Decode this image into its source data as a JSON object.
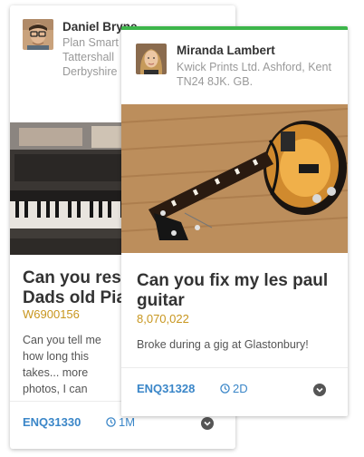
{
  "cards": [
    {
      "user": {
        "name": "Daniel Bryne",
        "address": "Plan Smart Tattershall Derbyshire"
      },
      "title": "Can you restore my Dads old Piano",
      "reference": "W6900156",
      "description": "Can you tell me how long this takes... more photos, I can",
      "enquiry_id": "ENQ31330",
      "duration": "1M"
    },
    {
      "user": {
        "name": "Miranda Lambert",
        "address": "Kwick Prints Ltd. Ashford, Kent TN24 8JK. GB."
      },
      "title": "Can you fix my les paul guitar",
      "reference": "8,070,022",
      "description": "Broke during a gig at Glastonbury!",
      "enquiry_id": "ENQ31328",
      "duration": "2D"
    }
  ],
  "colors": {
    "accent_green": "#3cb54a",
    "link_blue": "#3a86c8",
    "ref_gold": "#c8961e"
  }
}
